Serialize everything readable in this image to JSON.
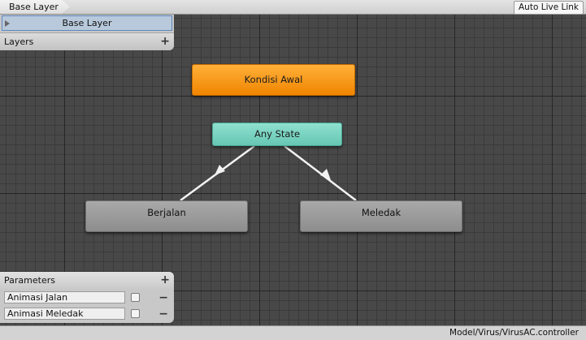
{
  "breadcrumb": {
    "label": "Base Layer"
  },
  "toolbar": {
    "auto_live_link": "Auto Live Link"
  },
  "layers": {
    "title": "Layers",
    "add_label": "+",
    "items": [
      {
        "label": "Base Layer"
      }
    ]
  },
  "parameters": {
    "title": "Parameters",
    "add_label": "+",
    "items": [
      {
        "name": "Animasi Jalan",
        "checked": false,
        "remove_label": "−"
      },
      {
        "name": "Animasi Meledak",
        "checked": false,
        "remove_label": "−"
      }
    ]
  },
  "states": {
    "entry": {
      "label": "Kondisi Awal",
      "color": "#f39100"
    },
    "any": {
      "label": "Any State",
      "color": "#74d1bf"
    },
    "berjalan": {
      "label": "Berjalan",
      "color": "#9a9a9a"
    },
    "meledak": {
      "label": "Meledak",
      "color": "#9a9a9a"
    }
  },
  "status": {
    "path": "Model/Virus/VirusAC.controller"
  }
}
